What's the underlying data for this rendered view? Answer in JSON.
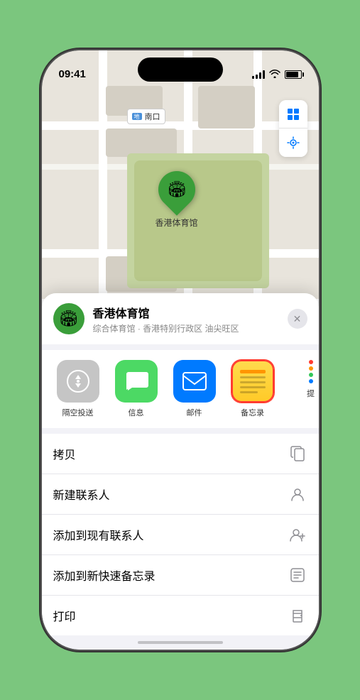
{
  "status_bar": {
    "time": "09:41",
    "location_arrow": "▶"
  },
  "map": {
    "label_text": "南口",
    "station_icon": "地"
  },
  "location": {
    "name": "香港体育馆",
    "subtitle": "综合体育馆 · 香港特别行政区 油尖旺区",
    "pin_emoji": "🏟"
  },
  "share_items": [
    {
      "id": "airdrop",
      "label": "隔空投送"
    },
    {
      "id": "messages",
      "label": "信息"
    },
    {
      "id": "mail",
      "label": "邮件"
    },
    {
      "id": "notes",
      "label": "备忘录"
    },
    {
      "id": "more",
      "label": "提"
    }
  ],
  "more_dots_colors": [
    "#ff3b30",
    "#ff9500",
    "#34c759",
    "#007aff"
  ],
  "action_rows": [
    {
      "id": "copy",
      "label": "拷贝"
    },
    {
      "id": "new-contact",
      "label": "新建联系人"
    },
    {
      "id": "add-contact",
      "label": "添加到现有联系人"
    },
    {
      "id": "quick-note",
      "label": "添加到新快速备忘录"
    },
    {
      "id": "print",
      "label": "打印"
    }
  ]
}
